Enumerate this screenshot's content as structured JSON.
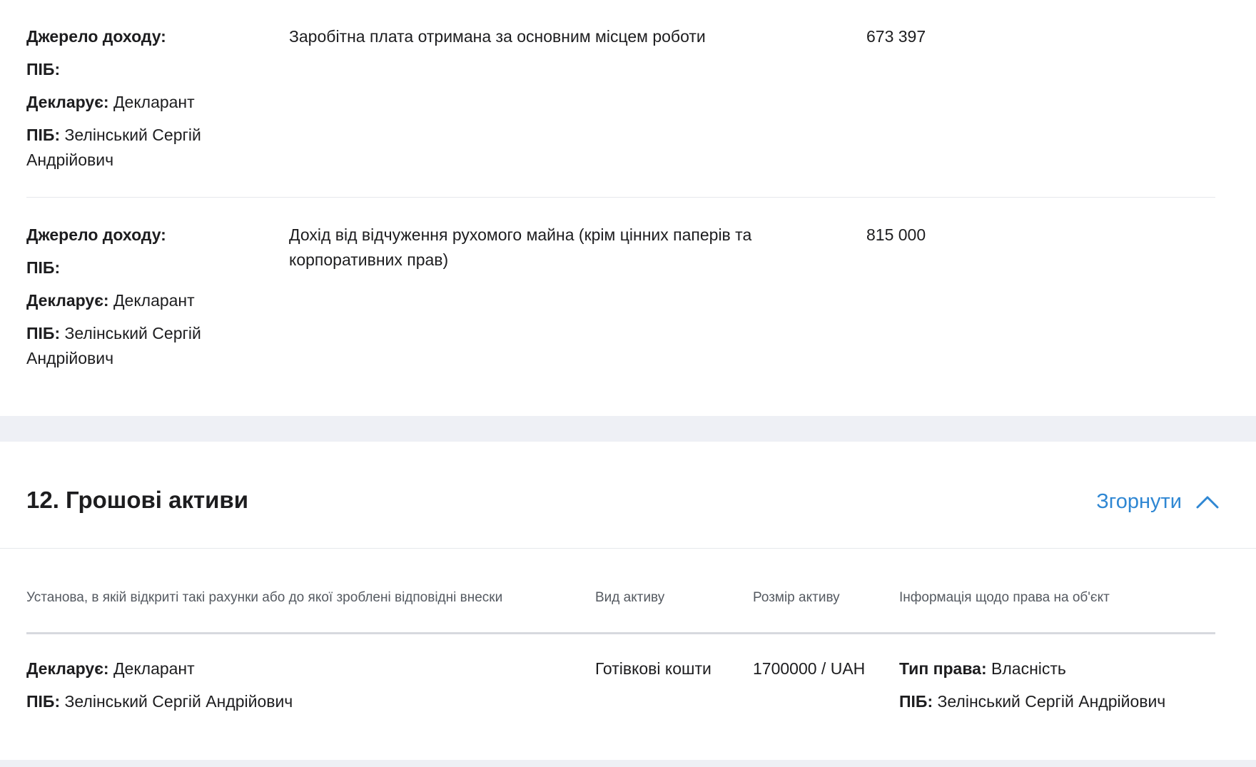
{
  "income": {
    "rows": [
      {
        "source_label": "Джерело доходу:",
        "pib_label": "ПІБ:",
        "declares_label": "Декларує:",
        "declares_value": "Декларант",
        "pib2_label": "ПІБ:",
        "pib2_value": "Зелінський Сергій Андрійович",
        "type": "Заробітна плата отримана за основним місцем роботи",
        "amount": "673 397"
      },
      {
        "source_label": "Джерело доходу:",
        "pib_label": "ПІБ:",
        "declares_label": "Декларує:",
        "declares_value": "Декларант",
        "pib2_label": "ПІБ:",
        "pib2_value": "Зелінський Сергій Андрійович",
        "type": "Дохід від відчуження рухомого майна (крім цінних паперів та корпоративних прав)",
        "amount": "815 000"
      }
    ]
  },
  "section12": {
    "title": "12. Грошові активи",
    "collapse_label": "Згорнути",
    "collapse_icon": "chevron-up-icon",
    "accent_color": "#2f87d3",
    "columns": [
      "Установа, в якій відкриті такі рахунки або до якої зроблені відповідні внески",
      "Вид активу",
      "Розмір активу",
      "Інформація щодо права на об'єкт"
    ],
    "rows": [
      {
        "declares_label": "Декларує:",
        "declares_value": "Декларант",
        "pib_label": "ПІБ:",
        "pib_value": "Зелінський Сергій Андрійович",
        "asset_type": "Готівкові кошти",
        "asset_size": "1700000 / UAH",
        "right_type_label": "Тип права:",
        "right_type_value": "Власність",
        "owner_pib_label": "ПІБ:",
        "owner_pib_value": "Зелінський Сергій Андрійович"
      }
    ]
  }
}
